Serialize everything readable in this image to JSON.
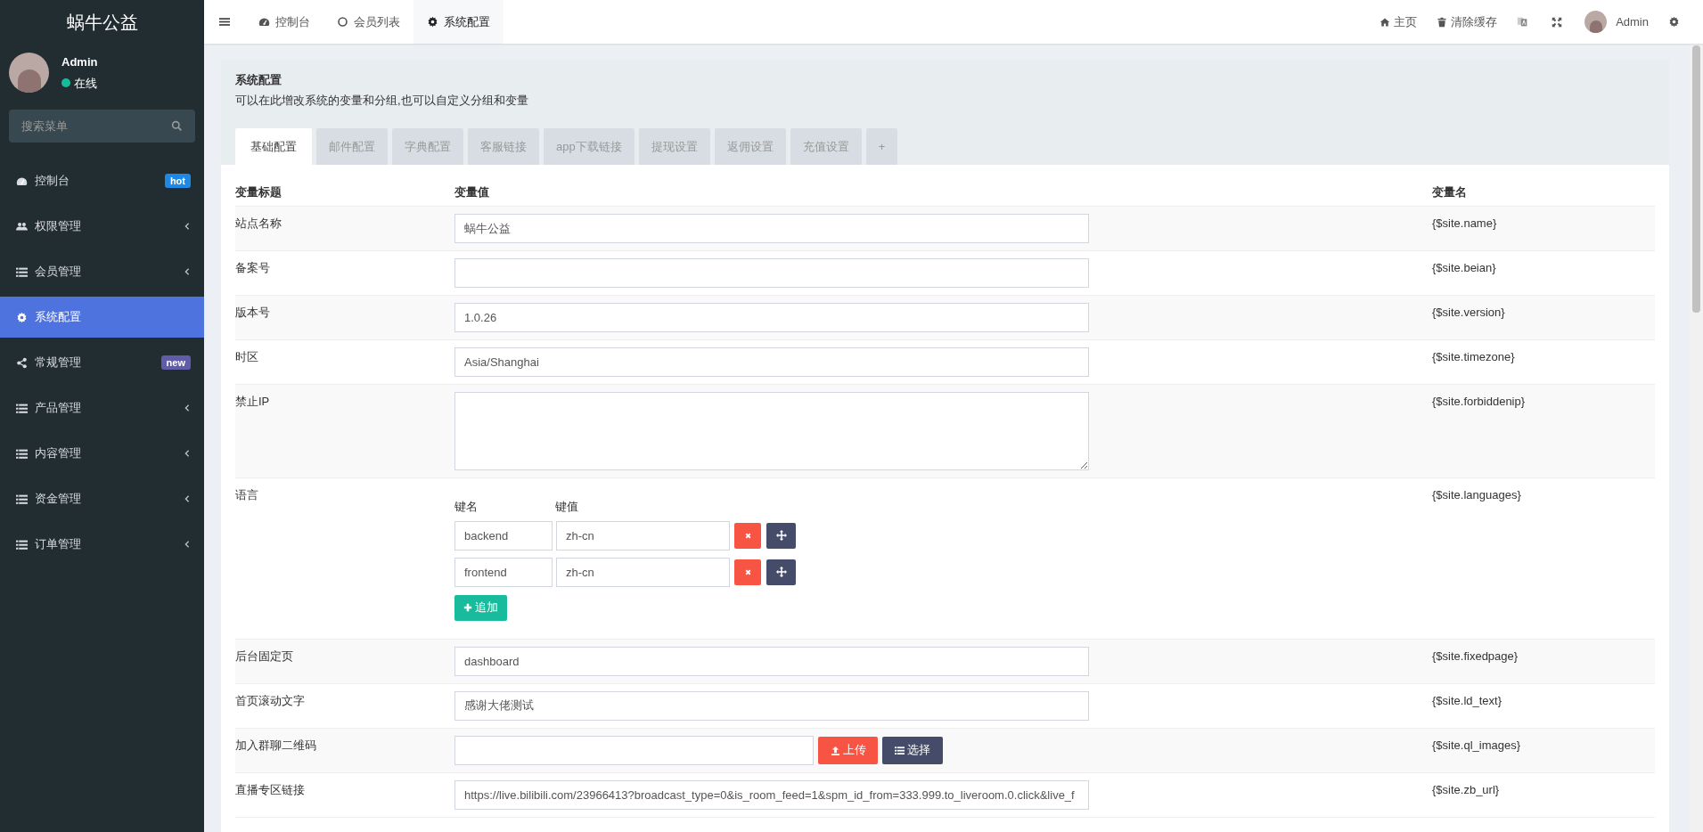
{
  "sidebar": {
    "brand": "蜗牛公益",
    "user": {
      "name": "Admin",
      "status": "在线",
      "online": true
    },
    "search": {
      "placeholder": "搜索菜单"
    },
    "items": [
      {
        "label": "控制台",
        "kind": "dashboard",
        "badge": {
          "text": "hot",
          "color": "#1e88e5"
        },
        "expandable": false,
        "selected": false
      },
      {
        "label": "权限管理",
        "kind": "users",
        "expandable": true,
        "selected": false
      },
      {
        "label": "会员管理",
        "kind": "list",
        "expandable": true,
        "selected": false
      },
      {
        "label": "系统配置",
        "kind": "gear",
        "expandable": false,
        "selected": true
      },
      {
        "label": "常规管理",
        "kind": "share",
        "badge": {
          "text": "new",
          "color": "#605ca8"
        },
        "expandable": false,
        "selected": false
      },
      {
        "label": "产品管理",
        "kind": "list",
        "expandable": true,
        "selected": false
      },
      {
        "label": "内容管理",
        "kind": "list",
        "expandable": true,
        "selected": false
      },
      {
        "label": "资金管理",
        "kind": "list",
        "expandable": true,
        "selected": false
      },
      {
        "label": "订单管理",
        "kind": "list",
        "expandable": true,
        "selected": false
      }
    ]
  },
  "header": {
    "tabs": [
      {
        "label": "控制台",
        "kind": "dashboard",
        "selected": false
      },
      {
        "label": "会员列表",
        "kind": "circle",
        "selected": false
      },
      {
        "label": "系统配置",
        "kind": "gear",
        "selected": true
      }
    ],
    "links": [
      {
        "label": "主页",
        "kind": "home"
      },
      {
        "label": "清除缓存",
        "kind": "trash"
      }
    ],
    "user": "Admin"
  },
  "panel": {
    "title": "系统配置",
    "description": "可以在此增改系统的变量和分组,也可以自定义分组和变量",
    "tabs": [
      {
        "label": "基础配置",
        "selected": true
      },
      {
        "label": "邮件配置",
        "selected": false
      },
      {
        "label": "字典配置",
        "selected": false
      },
      {
        "label": "客服链接",
        "selected": false
      },
      {
        "label": "app下载链接",
        "selected": false
      },
      {
        "label": "提现设置",
        "selected": false
      },
      {
        "label": "返佣设置",
        "selected": false
      },
      {
        "label": "充值设置",
        "selected": false
      },
      {
        "label": "+",
        "selected": false
      }
    ]
  },
  "table": {
    "columns": [
      "变量标题",
      "变量值",
      "变量名"
    ],
    "rows": [
      {
        "kind": "input",
        "title": "站点名称",
        "value": "蜗牛公益",
        "variable": "{$site.name}"
      },
      {
        "kind": "input",
        "title": "备案号",
        "value": "",
        "variable": "{$site.beian}"
      },
      {
        "kind": "input",
        "title": "版本号",
        "value": "1.0.26",
        "variable": "{$site.version}"
      },
      {
        "kind": "input",
        "title": "时区",
        "value": "Asia/Shanghai",
        "variable": "{$site.timezone}"
      },
      {
        "kind": "textarea",
        "title": "禁止IP",
        "value": "",
        "variable": "{$site.forbiddenip}"
      },
      {
        "kind": "keyvalue",
        "title": "语言",
        "key_label": "键名",
        "value_label": "键值",
        "pairs": [
          {
            "key": "backend",
            "value": "zh-cn"
          },
          {
            "key": "frontend",
            "value": "zh-cn"
          }
        ],
        "add_label": "追加",
        "variable": "{$site.languages}"
      },
      {
        "kind": "input",
        "title": "后台固定页",
        "value": "dashboard",
        "variable": "{$site.fixedpage}"
      },
      {
        "kind": "input",
        "title": "首页滚动文字",
        "value": "感谢大佬测试",
        "variable": "{$site.ld_text}"
      },
      {
        "kind": "upload",
        "title": "加入群聊二维码",
        "value": "",
        "upload_label": "上传",
        "choose_label": "选择",
        "variable": "{$site.ql_images}"
      },
      {
        "kind": "input",
        "title": "直播专区链接",
        "value": "https://live.bilibili.com/23966413?broadcast_type=0&is_room_feed=1&spm_id_from=333.999.to_liveroom.0.click&live_f",
        "variable": "{$site.zb_url}"
      }
    ]
  }
}
